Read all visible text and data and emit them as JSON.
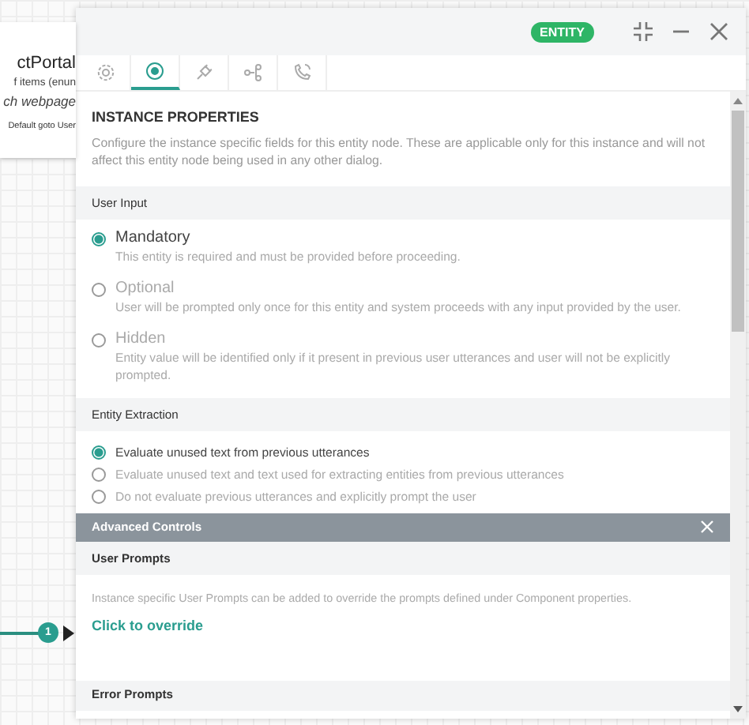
{
  "canvas": {
    "node": {
      "title": "ctPortal",
      "lines": [
        "f items (enun",
        "ch webpage"
      ],
      "footer": "Default goto User"
    },
    "connector": {
      "badge": "1"
    }
  },
  "panel": {
    "badge": "ENTITY",
    "tabs": [
      {
        "kind": "settings",
        "selected": false
      },
      {
        "kind": "target",
        "selected": true
      },
      {
        "kind": "plug",
        "selected": false
      },
      {
        "kind": "flow",
        "selected": false
      },
      {
        "kind": "phone",
        "selected": false
      }
    ],
    "title": "INSTANCE PROPERTIES",
    "description": "Configure the instance specific fields for this entity node. These are applicable only for this instance and will not affect this entity node being used in any other dialog.",
    "user_input": {
      "heading": "User Input",
      "options": [
        {
          "label": "Mandatory",
          "help": "This entity is required and must be provided before proceeding.",
          "selected": true
        },
        {
          "label": "Optional",
          "help": "User will be prompted only once for this entity and system proceeds with any input provided by the user.",
          "selected": false
        },
        {
          "label": "Hidden",
          "help": "Entity value will be identified only if it present in previous user utterances and user will not be explicitly prompted.",
          "selected": false
        }
      ]
    },
    "entity_extraction": {
      "heading": "Entity Extraction",
      "options": [
        {
          "label": "Evaluate unused text from previous utterances",
          "selected": true
        },
        {
          "label": "Evaluate unused text and text used for extracting entities from previous utterances",
          "selected": false
        },
        {
          "label": "Do not evaluate previous utterances and explicitly prompt the user",
          "selected": false
        }
      ]
    },
    "advanced": {
      "heading": "Advanced Controls",
      "user_prompts": {
        "heading": "User Prompts",
        "text": "Instance specific User Prompts can be added to override the prompts defined under Component properties.",
        "link": "Click to override"
      },
      "error_prompts": {
        "heading": "Error Prompts"
      }
    }
  }
}
